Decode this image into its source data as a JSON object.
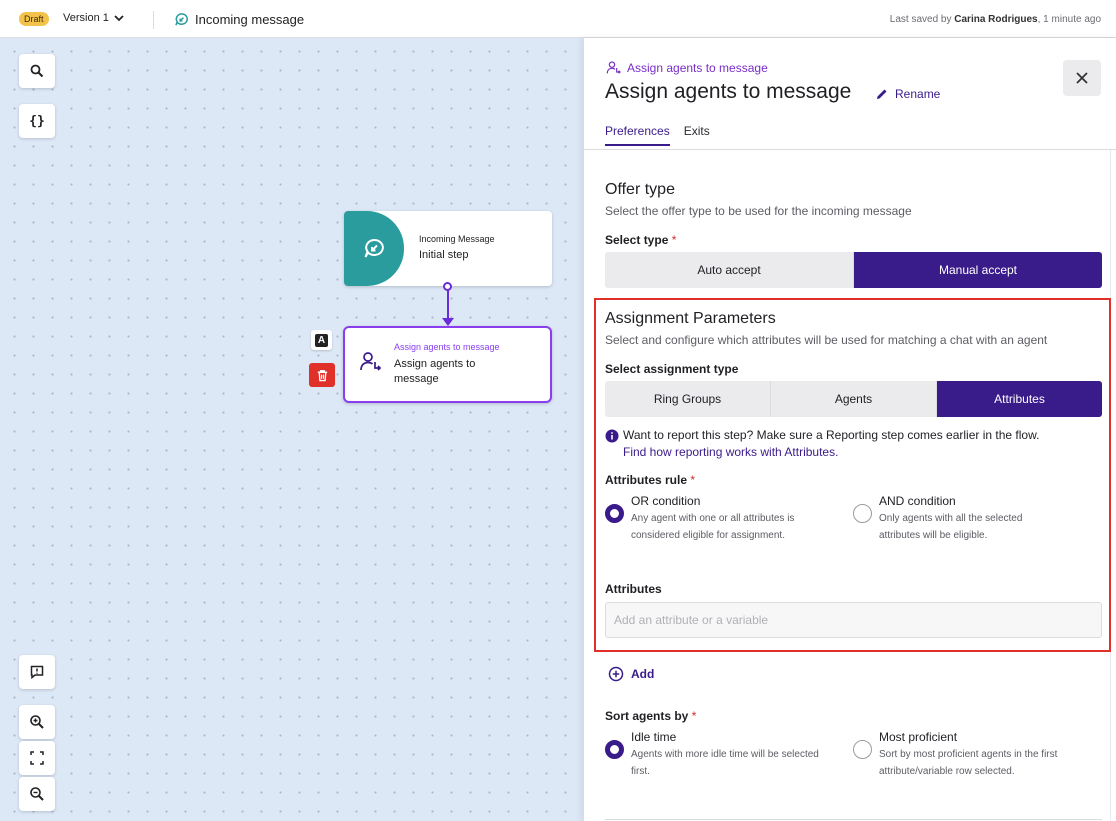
{
  "topbar": {
    "draft_label": "Draft",
    "version_label": "Version 1",
    "flow_title": "Incoming message",
    "saved_prefix": "Last saved by ",
    "saved_user": "Carina Rodrigues",
    "saved_suffix": ", 1 minute ago"
  },
  "canvas": {
    "tools": {
      "search_icon": "search-icon",
      "variables_label": "{}",
      "comment_icon": "comment-icon",
      "zoom_in_icon": "zoom-in-icon",
      "fit_icon": "fit-view-icon",
      "zoom_out_icon": "zoom-out-icon"
    },
    "nodes": {
      "incoming": {
        "title": "Incoming Message",
        "subtitle": "Initial step"
      },
      "assign": {
        "title": "Assign agents to message",
        "subtitle": "Assign agents to message"
      }
    },
    "node_badge": "A"
  },
  "panel": {
    "crumb": "Assign agents to message",
    "title": "Assign agents to message",
    "rename_label": "Rename",
    "tabs": [
      {
        "label": "Preferences",
        "active": true
      },
      {
        "label": "Exits",
        "active": false
      }
    ],
    "offer_type": {
      "title": "Offer type",
      "subtitle": "Select the offer type to be used for the incoming message",
      "select_label": "Select type",
      "required": "*",
      "options": [
        "Auto accept",
        "Manual accept"
      ],
      "selected": "Manual accept"
    },
    "assignment": {
      "title": "Assignment Parameters",
      "subtitle": "Select and configure which attributes will be used for matching a chat with an agent",
      "type_label": "Select assignment type",
      "types": [
        "Ring Groups",
        "Agents",
        "Attributes"
      ],
      "selected_type": "Attributes",
      "info_text": "Want to report this step? Make sure a Reporting step comes earlier in the flow.",
      "info_link": "Find how reporting works with Attributes.",
      "rule_label": "Attributes rule",
      "rule_options": [
        {
          "title": "OR condition",
          "desc": "Any agent with one or all attributes is considered eligible for assignment.",
          "selected": true
        },
        {
          "title": "AND condition",
          "desc": "Only agents with all the selected attributes will be eligible.",
          "selected": false
        }
      ],
      "attributes_label": "Attributes",
      "attributes_placeholder": "Add an attribute or a variable"
    },
    "add_label": "Add",
    "sort": {
      "label": "Sort agents by",
      "options": [
        {
          "title": "Idle time",
          "desc": "Agents with more idle time will be selected first.",
          "selected": true
        },
        {
          "title": "Most proficient",
          "desc": "Sort by most proficient agents in the first attribute/variable row selected.",
          "selected": false
        }
      ]
    }
  },
  "colors": {
    "accent": "#3a1b8a",
    "accent_light": "#8a3ef0",
    "teal": "#2a9c9e",
    "danger": "#e0302a",
    "draft": "#f3c24a"
  }
}
